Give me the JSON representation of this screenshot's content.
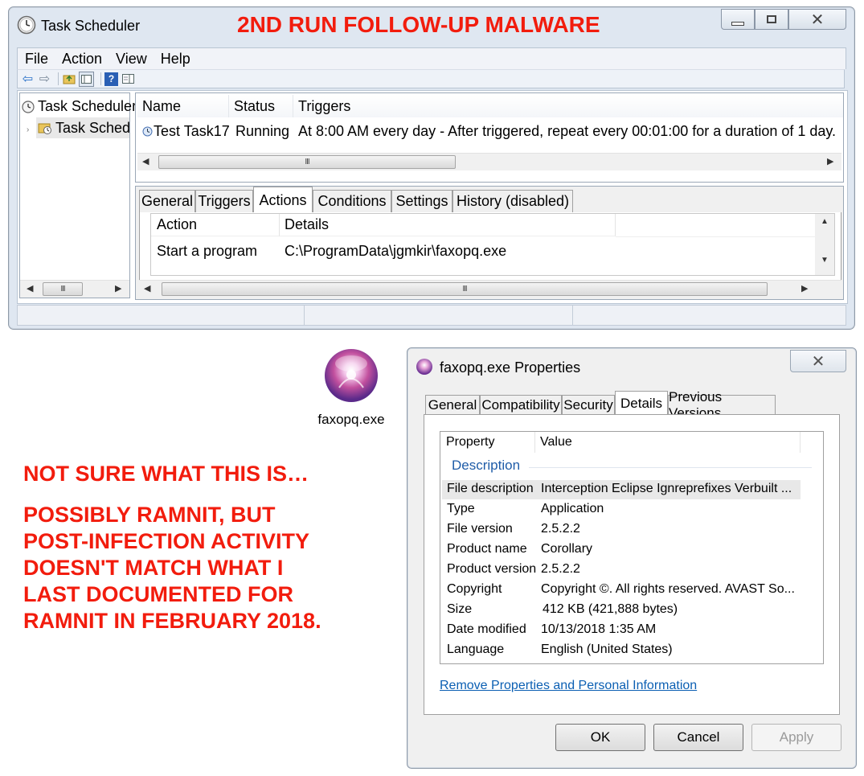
{
  "task_scheduler": {
    "title": "Task Scheduler",
    "menu": [
      "File",
      "Action",
      "View",
      "Help"
    ],
    "tree": {
      "root": "Task Scheduler",
      "child": "Task Scheduler Library"
    },
    "task_list": {
      "columns": [
        "Name",
        "Status",
        "Triggers"
      ],
      "rows": [
        {
          "name": "Test Task17",
          "status": "Running",
          "triggers": "At 8:00 AM every day - After triggered, repeat every 00:01:00 for a duration of 1 day."
        }
      ]
    },
    "tabs": [
      "General",
      "Triggers",
      "Actions",
      "Conditions",
      "Settings",
      "History (disabled)"
    ],
    "active_tab": "Actions",
    "actions_grid": {
      "columns": [
        "Action",
        "Details"
      ],
      "rows": [
        {
          "action": "Start a program",
          "details": "C:\\ProgramData\\jgmkir\\faxopq.exe"
        }
      ]
    },
    "scroll_thumb_glyph": "III"
  },
  "annotations": {
    "headline": "2ND RUN FOLLOW-UP MALWARE",
    "note1": "NOT SURE WHAT THIS IS…",
    "note2_lines": [
      "POSSIBLY RAMNIT, BUT",
      "POST-INFECTION ACTIVITY",
      "DOESN'T MATCH WHAT I",
      "LAST DOCUMENTED FOR",
      "RAMNIT IN FEBRUARY 2018."
    ]
  },
  "desktop_file": {
    "label": "faxopq.exe"
  },
  "properties_dialog": {
    "title": "faxopq.exe Properties",
    "tabs": [
      "General",
      "Compatibility",
      "Security",
      "Details",
      "Previous Versions"
    ],
    "active_tab": "Details",
    "columns": [
      "Property",
      "Value"
    ],
    "group": "Description",
    "rows": [
      {
        "property": "File description",
        "value": "Interception Eclipse Ignreprefixes Verbuilt ..."
      },
      {
        "property": "Type",
        "value": "Application"
      },
      {
        "property": "File version",
        "value": "2.5.2.2"
      },
      {
        "property": "Product name",
        "value": "Corollary"
      },
      {
        "property": "Product version",
        "value": "2.5.2.2"
      },
      {
        "property": "Copyright",
        "value": "Copyright ©.  All rights reserved. AVAST So..."
      },
      {
        "property": "Size",
        "value": "412 KB (421,888 bytes)"
      },
      {
        "property": "Date modified",
        "value": "10/13/2018 1:35 AM"
      },
      {
        "property": "Language",
        "value": "English (United States)"
      }
    ],
    "link": "Remove Properties and Personal Information",
    "buttons": {
      "ok": "OK",
      "cancel": "Cancel",
      "apply": "Apply"
    }
  },
  "colors": {
    "annotation_red": "#f21c0d",
    "link_blue": "#0b5fb3",
    "group_blue": "#1f5ca8"
  }
}
